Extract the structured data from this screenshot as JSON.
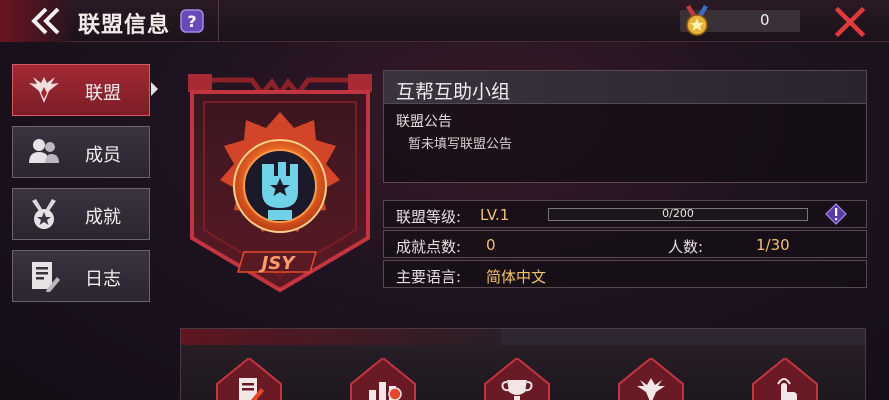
{
  "header": {
    "title": "联盟信息",
    "currency_value": "0"
  },
  "sidebar": {
    "items": [
      {
        "label": "联盟",
        "icon": "alliance-wings-icon",
        "active": true
      },
      {
        "label": "成员",
        "icon": "members-icon",
        "active": false
      },
      {
        "label": "成就",
        "icon": "medal-achievement-icon",
        "active": false
      },
      {
        "label": "日志",
        "icon": "log-document-icon",
        "active": false
      }
    ]
  },
  "emblem": {
    "text": "JSY",
    "icon": "fist-star-emblem-icon"
  },
  "alliance": {
    "name": "互帮互助小组",
    "notice_heading": "联盟公告",
    "notice_body": "暂未填写联盟公告"
  },
  "stats": {
    "level_label": "联盟等级:",
    "level_value": "LV.1",
    "level_progress_text": "0/200",
    "level_progress": 0,
    "points_label": "成就点数:",
    "points_value": "0",
    "members_label": "人数:",
    "members_value": "1/30",
    "language_label": "主要语言:",
    "language_value": "简体中文"
  },
  "colors": {
    "accent_red": "#a32a35",
    "gold_text": "#f5c26b",
    "emblem_orange": "#f0712a"
  },
  "function_buttons": [
    {
      "icon": "edit-notice-icon"
    },
    {
      "icon": "rank-chart-icon"
    },
    {
      "icon": "trophy-icon"
    },
    {
      "icon": "alliance-badge-icon"
    },
    {
      "icon": "hand-tap-icon"
    }
  ]
}
